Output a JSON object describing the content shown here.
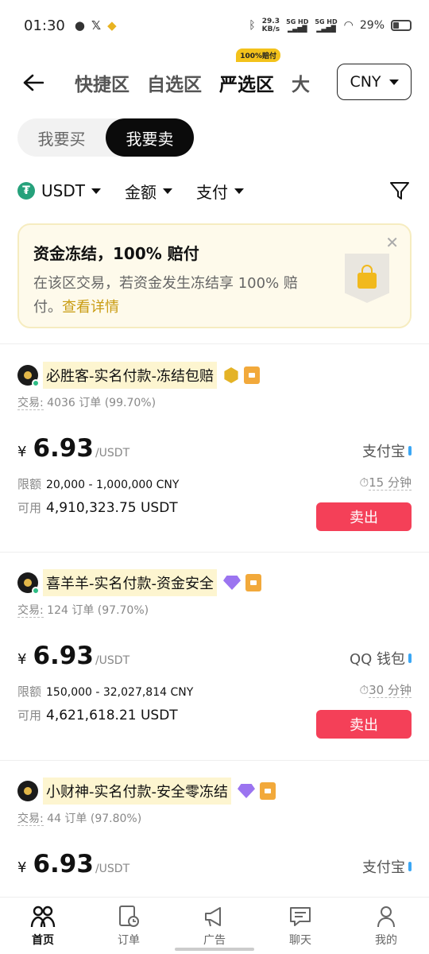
{
  "status_bar": {
    "time": "01:30",
    "speed_value": "29.3",
    "speed_unit": "KB/s",
    "sig1": "5G HD",
    "sig2": "5G HD",
    "battery": "29%"
  },
  "header": {
    "tabs": [
      {
        "label": "快捷区"
      },
      {
        "label": "自选区"
      },
      {
        "label": "严选区",
        "badge": "100%赔付"
      },
      {
        "label": "大"
      }
    ],
    "currency": "CNY"
  },
  "toggle": {
    "buy": "我要买",
    "sell": "我要卖"
  },
  "filters": {
    "asset": "USDT",
    "amount": "金额",
    "payment": "支付"
  },
  "banner": {
    "title": "资金冻结，100% 赔付",
    "desc": "在该区交易，若资金发生冻结享 100% 赔付。",
    "link": "查看详情"
  },
  "offers": [
    {
      "merchant": "必胜客-实名付款-冻结包赔",
      "stats_label": "交易:",
      "stats_value": "4036 订单",
      "rate": "(99.70%)",
      "currency_symbol": "¥",
      "price": "6.93",
      "unit": "/USDT",
      "payment": "支付宝",
      "limit_label": "限额",
      "limit": "20,000 - 1,000,000 CNY",
      "avail_label": "可用",
      "available": "4,910,323.75 USDT",
      "time": "15 分钟",
      "action": "卖出"
    },
    {
      "merchant": "喜羊羊-实名付款-资金安全",
      "stats_label": "交易:",
      "stats_value": "124 订单",
      "rate": "(97.70%)",
      "currency_symbol": "¥",
      "price": "6.93",
      "unit": "/USDT",
      "payment": "QQ 钱包",
      "limit_label": "限额",
      "limit": "150,000 - 32,027,814 CNY",
      "avail_label": "可用",
      "available": "4,621,618.21 USDT",
      "time": "30 分钟",
      "action": "卖出"
    },
    {
      "merchant": "小财神-实名付款-安全零冻结",
      "stats_label": "交易:",
      "stats_value": "44 订单",
      "rate": "(97.80%)",
      "currency_symbol": "¥",
      "price": "6.93",
      "unit": "/USDT",
      "payment": "支付宝"
    }
  ],
  "bottom_nav": [
    {
      "label": "首页",
      "icon": "home-icon"
    },
    {
      "label": "订单",
      "icon": "orders-icon"
    },
    {
      "label": "广告",
      "icon": "megaphone-icon"
    },
    {
      "label": "聊天",
      "icon": "chat-icon"
    },
    {
      "label": "我的",
      "icon": "user-icon"
    }
  ],
  "colors": {
    "accent_sell": "#f44058",
    "banner_bg": "#fefaeb",
    "link_gold": "#c99c12",
    "online_green": "#2ebd85"
  }
}
